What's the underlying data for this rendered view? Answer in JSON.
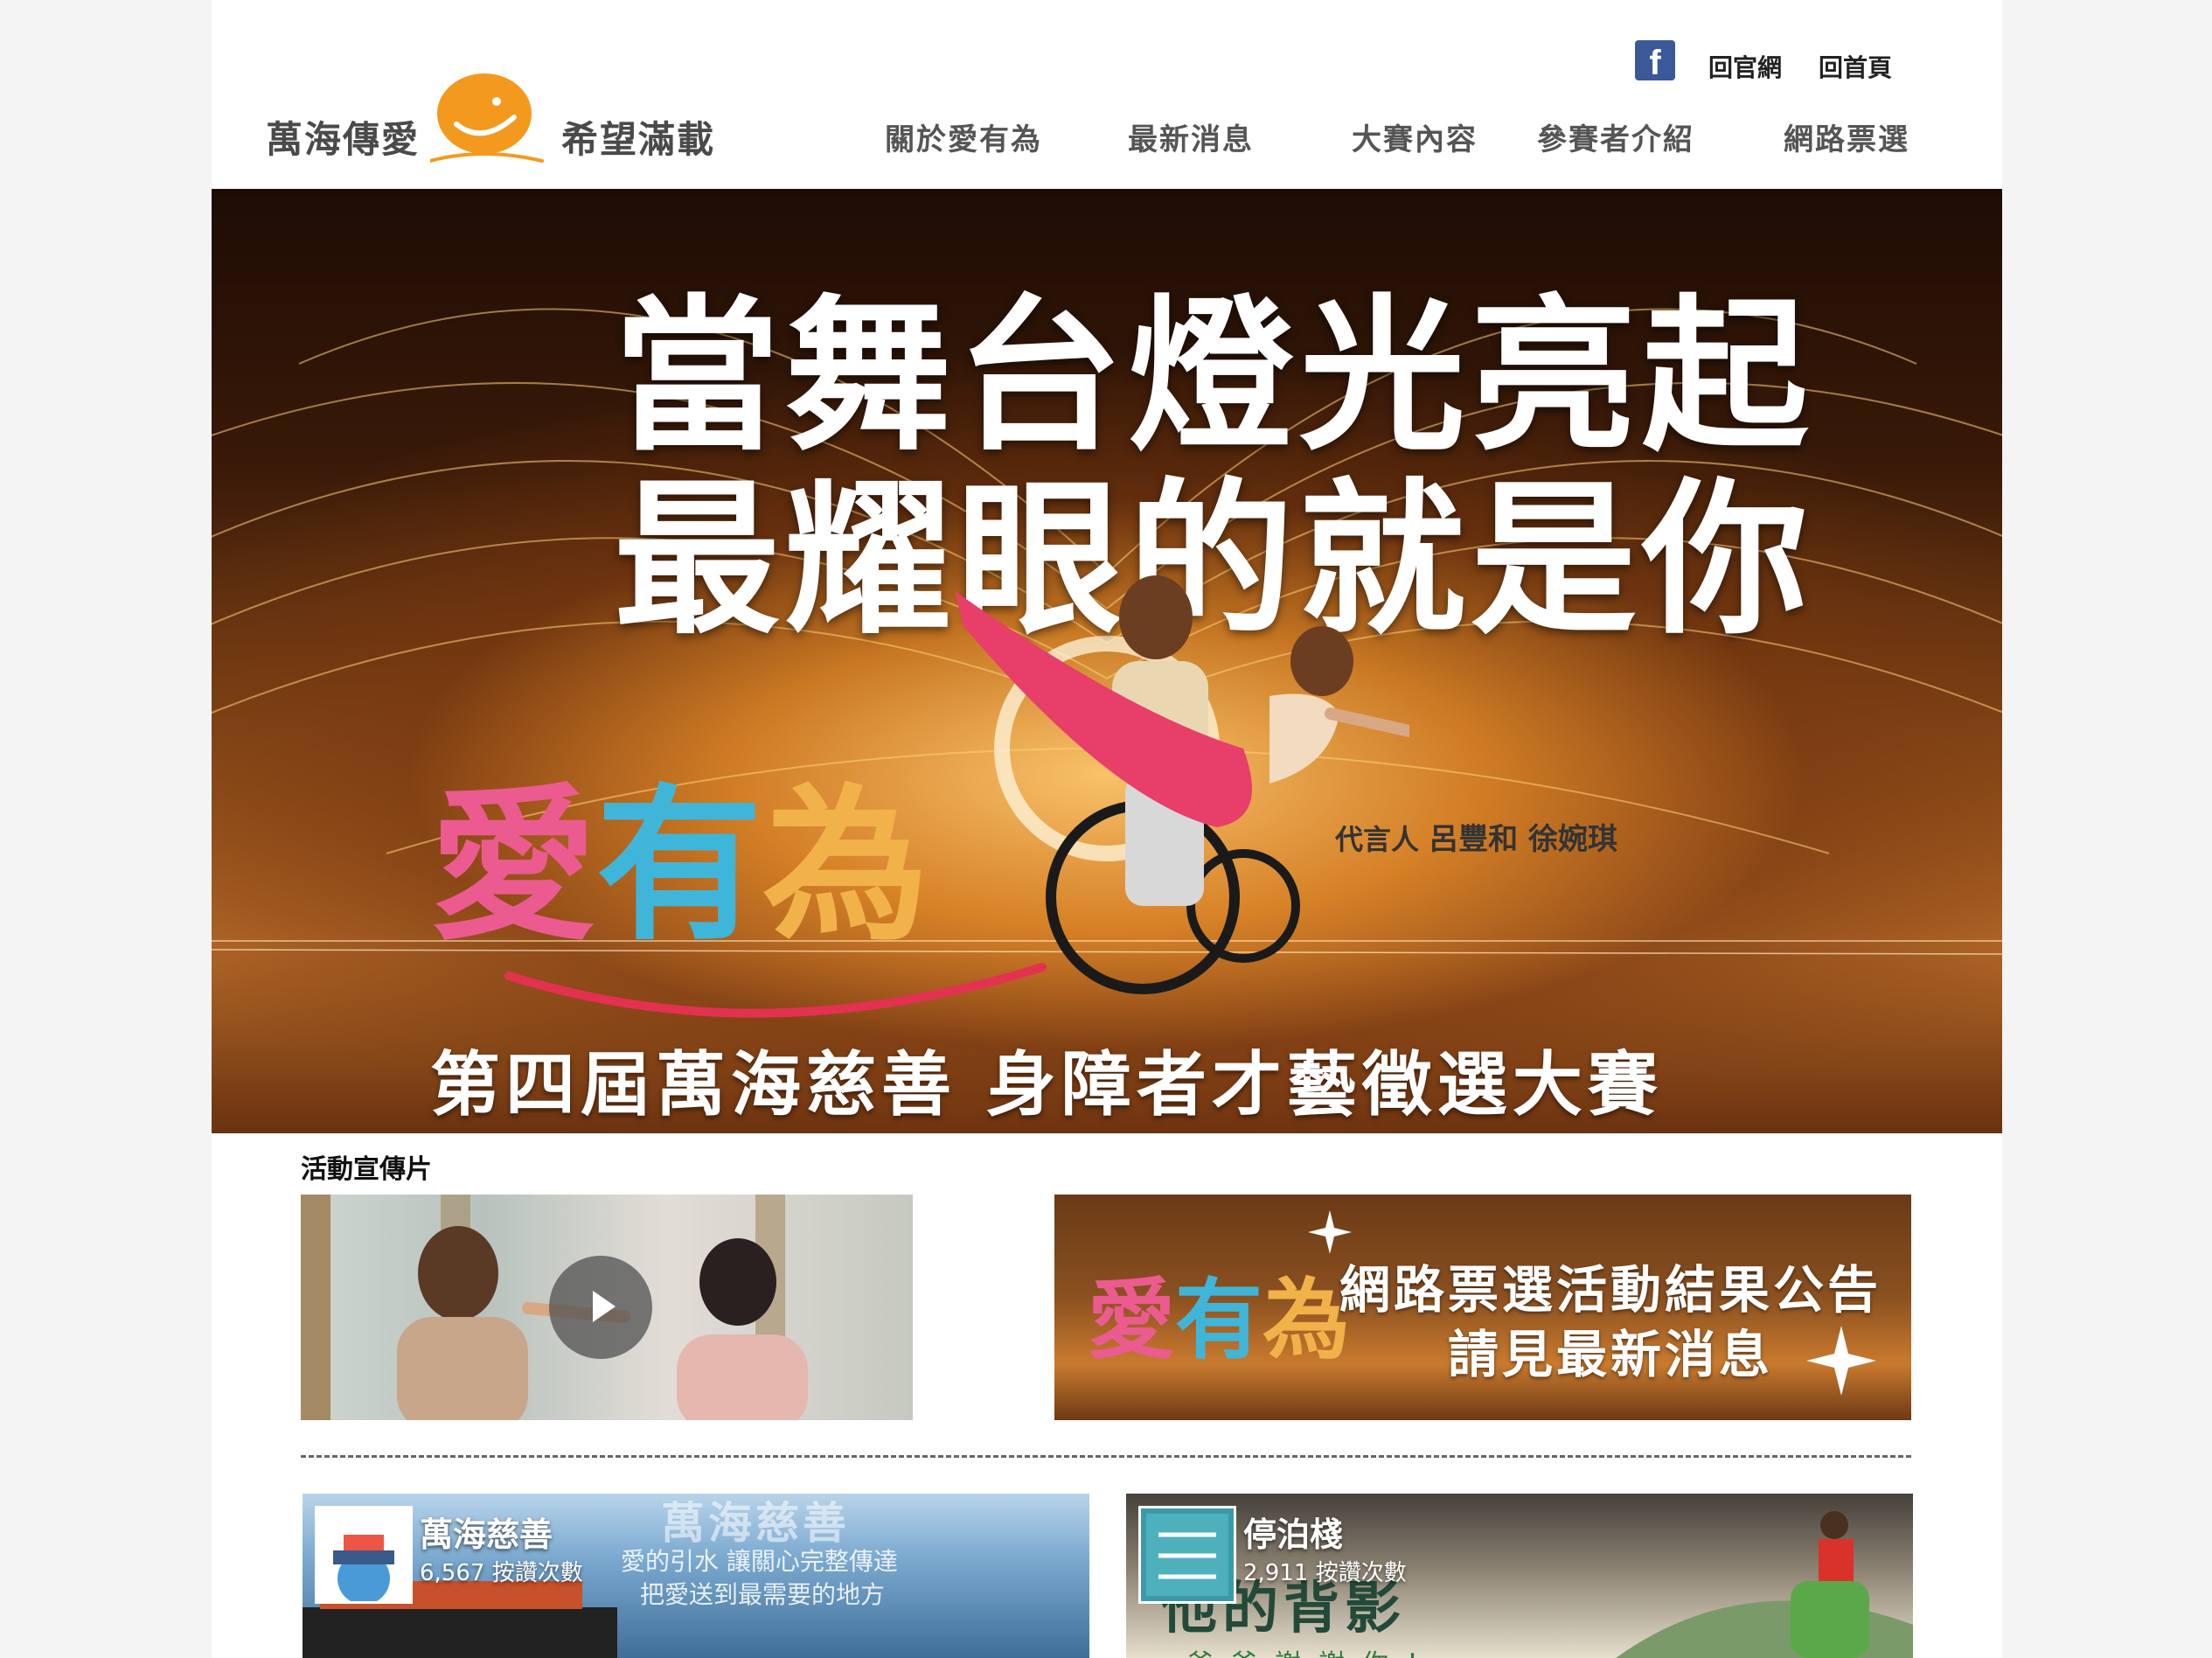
{
  "header": {
    "logo_left": "萬海傳愛",
    "logo_right": "希望滿載",
    "facebook_icon": "facebook-icon",
    "top_links": [
      "回官網",
      "回首頁"
    ],
    "nav": [
      "關於愛有為",
      "最新消息",
      "大賽內容",
      "參賽者介紹",
      "網路票選"
    ]
  },
  "hero": {
    "line1": "當舞台燈光亮起",
    "line2": "最耀眼的就是你",
    "logo_parts": [
      "愛",
      "有",
      "為"
    ],
    "spokes_label": "代言人",
    "spokes_names": "呂豐和 徐婉琪",
    "bottom": "第四屆萬海慈善 身障者才藝徵選大賽"
  },
  "promo": {
    "title": "活動宣傳片",
    "play_icon": "play-icon",
    "announce_logo_parts": [
      "愛",
      "有",
      "為"
    ],
    "announce_line1": "網路票選活動結果公告",
    "announce_line2": "請見最新消息"
  },
  "fb_pages": [
    {
      "name": "萬海慈善",
      "likes": "6,567 按讚次數",
      "bg_title": "萬海慈善",
      "bg_sub1": "愛的引水 讓關心完整傳達",
      "bg_sub2": "把愛送到最需要的地方"
    },
    {
      "name": "停泊棧",
      "likes": "2,911 按讚次數",
      "bg_big": "他的背影",
      "bg_small": "爸爸謝謝你！"
    }
  ],
  "colors": {
    "accent_orange": "#f39a1e",
    "facebook_blue": "#3b5998",
    "logo_pink": "#ec5b8f",
    "logo_blue": "#3fb6d9",
    "logo_yellow": "#f2b24a"
  }
}
